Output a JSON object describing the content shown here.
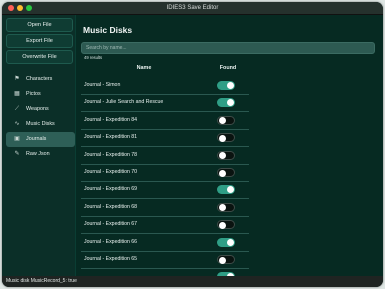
{
  "window": {
    "title": "IDIES3 Save Editor"
  },
  "sidebar": {
    "buttons": [
      {
        "label": "Open File"
      },
      {
        "label": "Export File"
      },
      {
        "label": "Overwrite File"
      }
    ],
    "nav": [
      {
        "label": "Characters",
        "icon": "characters-icon",
        "glyph": "⚑"
      },
      {
        "label": "Pictos",
        "icon": "pictos-icon",
        "glyph": "▦"
      },
      {
        "label": "Weapons",
        "icon": "weapons-icon",
        "glyph": "⟋"
      },
      {
        "label": "Music Disks",
        "icon": "music-icon",
        "glyph": "∿"
      },
      {
        "label": "Journals",
        "icon": "journals-icon",
        "glyph": "▣"
      },
      {
        "label": "Raw Json",
        "icon": "raw-json-icon",
        "glyph": "✎"
      }
    ],
    "active_index": 4
  },
  "main": {
    "title": "Music Disks",
    "search": {
      "placeholder": "Search by name...",
      "value": ""
    },
    "results": "49 results",
    "table": {
      "col_name": "Name",
      "col_found": "Found",
      "rows": [
        {
          "name": "Journal - Simon",
          "found": true
        },
        {
          "name": "Journal - Julie Search and Rescue",
          "found": true
        },
        {
          "name": "Journal - Expedition 84",
          "found": false
        },
        {
          "name": "Journal - Expedition 81",
          "found": false
        },
        {
          "name": "Journal - Expedition 78",
          "found": false
        },
        {
          "name": "Journal - Expedition 70",
          "found": false
        },
        {
          "name": "Journal - Expedition 69",
          "found": true
        },
        {
          "name": "Journal - Expedition 68",
          "found": false
        },
        {
          "name": "Journal - Expedition 67",
          "found": false
        },
        {
          "name": "Journal - Expedition 66",
          "found": true
        },
        {
          "name": "Journal - Expedition 65",
          "found": false
        },
        {
          "name": "",
          "found": true
        }
      ]
    }
  },
  "status": {
    "text": "Music disk MusicRecord_5: true"
  },
  "colors": {
    "background": "#062a22",
    "sidebar": "#0b2f28",
    "active_nav": "#2e5f57",
    "toggle_on": "#2f9e86",
    "toggle_off": "#0a1310"
  }
}
